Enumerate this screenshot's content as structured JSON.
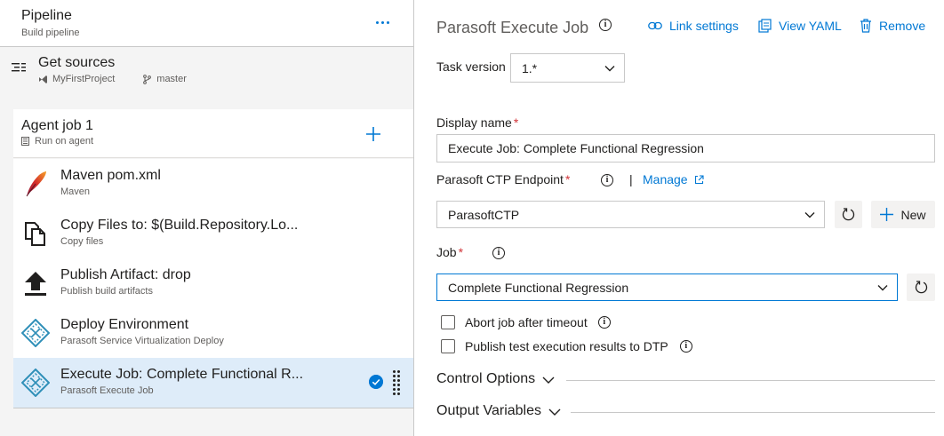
{
  "pipeline": {
    "title": "Pipeline",
    "subtitle": "Build pipeline",
    "more_label": "..."
  },
  "get_sources": {
    "title": "Get sources",
    "repo": "MyFirstProject",
    "branch": "master"
  },
  "agent_job": {
    "title": "Agent job 1",
    "subtitle": "Run on agent"
  },
  "tasks": [
    {
      "title": "Maven pom.xml",
      "subtitle": "Maven",
      "icon": "maven-feather-icon"
    },
    {
      "title": "Copy Files to: $(Build.Repository.Lo...",
      "subtitle": "Copy files",
      "icon": "copy-files-icon"
    },
    {
      "title": "Publish Artifact: drop",
      "subtitle": "Publish build artifacts",
      "icon": "upload-icon"
    },
    {
      "title": "Deploy Environment",
      "subtitle": "Parasoft Service Virtualization Deploy",
      "icon": "parasoft-icon"
    },
    {
      "title": "Execute Job: Complete Functional R...",
      "subtitle": "Parasoft Execute Job",
      "icon": "parasoft-icon",
      "selected": true
    }
  ],
  "details": {
    "title": "Parasoft Execute Job",
    "link_settings": "Link settings",
    "view_yaml": "View YAML",
    "remove": "Remove",
    "task_version_label": "Task version",
    "task_version_value": "1.*",
    "display_name_label": "Display name",
    "display_name_value": "Execute Job: Complete Functional Regression",
    "endpoint_label": "Parasoft CTP Endpoint",
    "separator": "|",
    "manage": "Manage",
    "endpoint_value": "ParasoftCTP",
    "new_label": "New",
    "job_label": "Job",
    "job_value": "Complete Functional Regression",
    "required_mark": "*",
    "abort_label": "Abort job after timeout",
    "publish_label": "Publish test execution results to DTP",
    "control_options": "Control Options",
    "output_variables": "Output Variables"
  },
  "colors": {
    "accent": "#0078d4",
    "selected_bg": "#deecf9",
    "required": "#d13438",
    "panel_bg": "#f4f4f4"
  }
}
